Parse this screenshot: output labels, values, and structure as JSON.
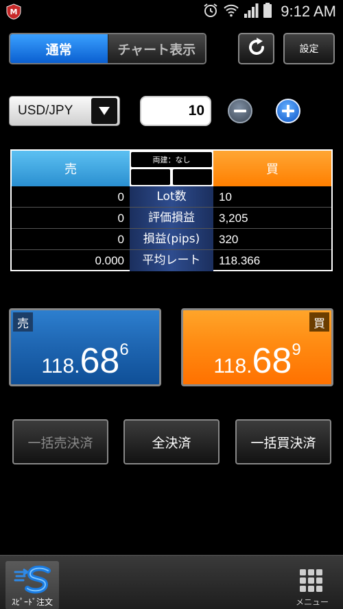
{
  "status_bar": {
    "time": "9:12 AM",
    "icons": [
      "mcafee-icon",
      "alarm-icon",
      "wifi-icon",
      "signal-icon",
      "battery-icon"
    ]
  },
  "toolbar": {
    "tabs": [
      {
        "label": "通常",
        "active": true
      },
      {
        "label": "チャート表示",
        "active": false
      }
    ],
    "refresh_icon": "refresh-icon",
    "settings_label": "設定"
  },
  "order": {
    "currency_pair": "USD/JPY",
    "lot": "10"
  },
  "position": {
    "sell_header": "売",
    "buy_header": "買",
    "hedge_label": "両建：なし",
    "rows": [
      {
        "sell": "0",
        "label": "Lot数",
        "buy": "10"
      },
      {
        "sell": "0",
        "label": "評価損益",
        "buy": "3,205"
      },
      {
        "sell": "0",
        "label": "損益(pips)",
        "buy": "320"
      },
      {
        "sell": "0.000",
        "label": "平均レート",
        "buy": "118.366"
      }
    ]
  },
  "prices": {
    "sell": {
      "tag": "売",
      "prefix": "118.",
      "big": "68",
      "sup": "6"
    },
    "buy": {
      "tag": "買",
      "prefix": "118.",
      "big": "68",
      "sup": "9"
    }
  },
  "settle": {
    "sell_all": "一括売決済",
    "all": "全決済",
    "buy_all": "一括買決済"
  },
  "bottom_nav": {
    "speed_label": "ｽﾋﾟｰﾄﾞ注文",
    "menu_label": "メニュー"
  },
  "colors": {
    "active_tab": "#1a7ae6",
    "sell": "#1f67b3",
    "buy": "#ff8b12"
  }
}
